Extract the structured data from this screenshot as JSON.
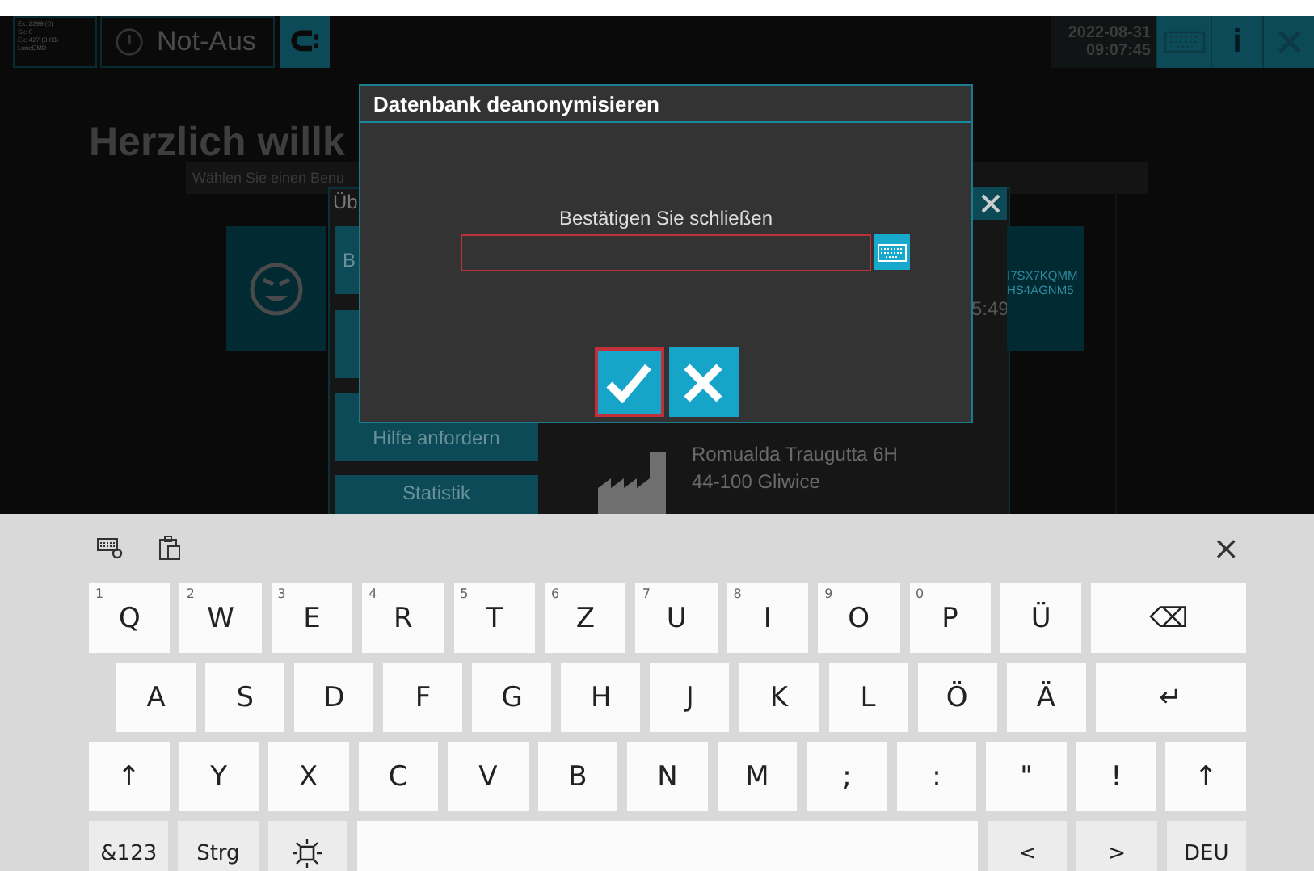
{
  "status_panel": {
    "lines": [
      "Ex: 2299 (0)",
      "Sx: 0",
      "Ex: 427 (3:03)",
      "LuneEMD"
    ]
  },
  "top_bar": {
    "emergency_stop": "Not-Aus",
    "date": "2022-08-31",
    "time": "09:07:45",
    "info": "i"
  },
  "background": {
    "heading": "Herzlich willk",
    "user_prompt": "Wählen Sie einen Benu",
    "panel_title": "Üb",
    "menu_buttons": [
      {
        "kind": "edge",
        "label": "B"
      },
      {
        "kind": "blank"
      },
      {
        "kind": "low",
        "label": "Hilfe anfordern"
      },
      {
        "kind": "high",
        "label": "Statistik"
      }
    ],
    "time_fragment": "5:49",
    "code_lines": [
      "I7SX7KQMM",
      "HS4AGNM5"
    ],
    "address": [
      "Romualda Traugutta 6H",
      "44-100 Gliwice"
    ]
  },
  "dialog": {
    "title": "Datenbank deanonymisieren",
    "label": "Bestätigen Sie schließen",
    "buttons": [
      {
        "kind": "confirm",
        "focused": true
      },
      {
        "kind": "cancel",
        "focused": false
      }
    ]
  },
  "keyboard": {
    "close": "×",
    "rows": [
      {
        "keys": [
          {
            "label": "Q",
            "hint": "1",
            "kind": "char"
          },
          {
            "label": "W",
            "hint": "2",
            "kind": "char"
          },
          {
            "label": "E",
            "hint": "3",
            "kind": "char"
          },
          {
            "label": "R",
            "hint": "4",
            "kind": "char"
          },
          {
            "label": "T",
            "hint": "5",
            "kind": "char"
          },
          {
            "label": "Z",
            "hint": "6",
            "kind": "char"
          },
          {
            "label": "U",
            "hint": "7",
            "kind": "char"
          },
          {
            "label": "I",
            "hint": "8",
            "kind": "char"
          },
          {
            "label": "O",
            "hint": "9",
            "kind": "char"
          },
          {
            "label": "P",
            "hint": "0",
            "kind": "char"
          },
          {
            "label": "Ü",
            "kind": "char"
          },
          {
            "label": "⌫",
            "kind": "wide"
          }
        ]
      },
      {
        "keys": [
          {
            "label": "A",
            "kind": "char"
          },
          {
            "label": "S",
            "kind": "char"
          },
          {
            "label": "D",
            "kind": "char"
          },
          {
            "label": "F",
            "kind": "char"
          },
          {
            "label": "G",
            "kind": "char"
          },
          {
            "label": "H",
            "kind": "char"
          },
          {
            "label": "J",
            "kind": "char"
          },
          {
            "label": "K",
            "kind": "char"
          },
          {
            "label": "L",
            "kind": "char"
          },
          {
            "label": "Ö",
            "kind": "char"
          },
          {
            "label": "Ä",
            "kind": "char"
          },
          {
            "label": "↵",
            "kind": "wide"
          }
        ]
      },
      {
        "keys": [
          {
            "label": "↑",
            "kind": "char"
          },
          {
            "label": "Y",
            "kind": "char"
          },
          {
            "label": "X",
            "kind": "char"
          },
          {
            "label": "C",
            "kind": "char"
          },
          {
            "label": "V",
            "kind": "char"
          },
          {
            "label": "B",
            "kind": "char"
          },
          {
            "label": "N",
            "kind": "char"
          },
          {
            "label": "M",
            "kind": "char"
          },
          {
            "label": ";",
            "kind": "char"
          },
          {
            "label": ":",
            "kind": "char"
          },
          {
            "label": "\"",
            "kind": "char"
          },
          {
            "label": "!",
            "kind": "char"
          },
          {
            "label": "↑",
            "kind": "char"
          }
        ]
      },
      {
        "keys": [
          {
            "label": "&123",
            "kind": "fn"
          },
          {
            "label": "Strg",
            "kind": "fn"
          },
          {
            "kind": "brightness"
          },
          {
            "kind": "space"
          },
          {
            "label": "<",
            "kind": "fn"
          },
          {
            "label": ">",
            "kind": "fn"
          },
          {
            "label": "DEU",
            "kind": "fn"
          }
        ]
      }
    ]
  }
}
